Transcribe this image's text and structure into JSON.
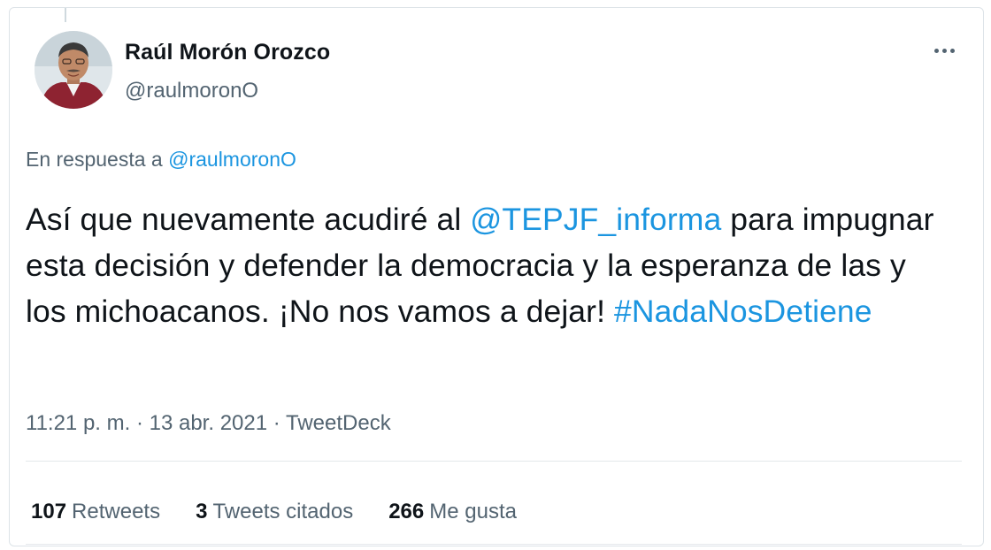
{
  "user": {
    "name": "Raúl Morón Orozco",
    "handle": "@raulmoronO",
    "avatar_icon": "user-avatar-photo"
  },
  "more_icon": "more-horizontal-icon",
  "reply": {
    "prefix": "En respuesta a ",
    "mention": "@raulmoronO"
  },
  "tweet": {
    "part1": "Así que nuevamente acudiré al ",
    "mention": "@TEPJF_informa",
    "part2": " para impugnar esta decisión y defender la democracia y la esperanza de las y los michoacanos. ¡No nos vamos a dejar! ",
    "hashtag": "#NadaNosDetiene"
  },
  "meta": {
    "time": "11:21 p. m.",
    "sep1": " · ",
    "date": "13 abr. 2021",
    "sep2": " · ",
    "source": "TweetDeck"
  },
  "stats": [
    {
      "count": "107",
      "label": "Retweets"
    },
    {
      "count": "3",
      "label": "Tweets citados"
    },
    {
      "count": "266",
      "label": "Me gusta"
    }
  ],
  "colors": {
    "link": "#1b95e0",
    "muted": "#536471",
    "text": "#0f1419",
    "border": "#dde3e8"
  }
}
